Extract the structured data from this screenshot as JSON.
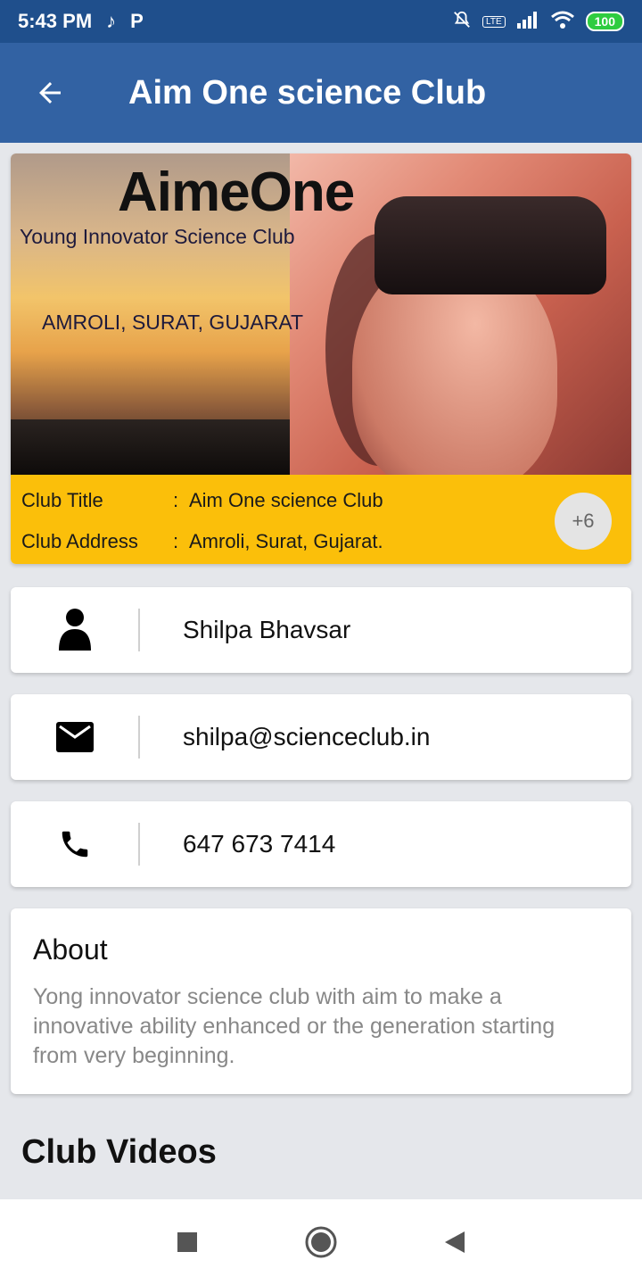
{
  "status_bar": {
    "time": "5:43 PM",
    "battery": "100"
  },
  "app_bar": {
    "title": "Aim One science Club"
  },
  "banner": {
    "brand_name": "AimeOne",
    "subtitle": "Young Innovator Science Club",
    "location": "AMROLI, SURAT, GUJARAT"
  },
  "club_info": {
    "title_label": "Club Title",
    "title_value": "Aim One science Club",
    "address_label": "Club Address",
    "address_value": "Amroli, Surat, Gujarat.",
    "separator": ":",
    "more_badge": "+6"
  },
  "contacts": {
    "name": "Shilpa Bhavsar",
    "email": "shilpa@scienceclub.in",
    "phone": "647 673 7414"
  },
  "about": {
    "title": "About",
    "text": "Yong innovator science club with aim to make a innovative ability enhanced or the generation starting from very beginning."
  },
  "videos_section": {
    "title": "Club Videos"
  },
  "colors": {
    "app_bar": "#3262a3",
    "status_bar": "#1f4f8c",
    "info_strip": "#fbbf0a"
  }
}
